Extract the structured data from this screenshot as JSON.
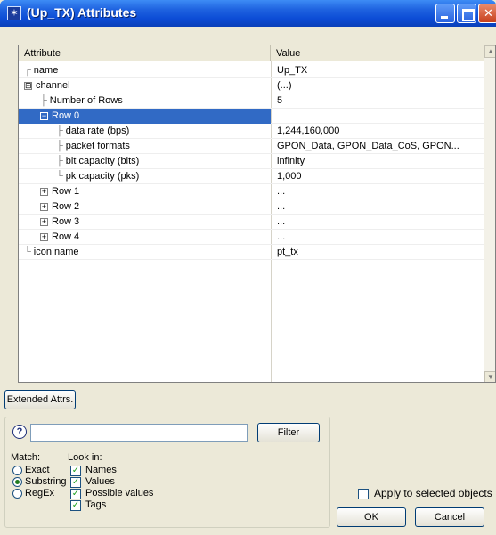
{
  "window": {
    "title": "(Up_TX) Attributes",
    "title_icon": "✶"
  },
  "grid": {
    "headers": {
      "attribute": "Attribute",
      "value": "Value"
    },
    "rows": [
      {
        "label": "name",
        "value": "Up_TX",
        "help": true,
        "indent": 0,
        "tree": "┌",
        "expander": ""
      },
      {
        "label": "channel",
        "value": "(...)",
        "help": true,
        "indent": 0,
        "tree": "",
        "expander": "⊟"
      },
      {
        "label": "Number of Rows",
        "value": "5",
        "help": true,
        "indent": 1,
        "tree": "├",
        "expander": ""
      },
      {
        "label": "Row 0",
        "value": "",
        "help": false,
        "indent": 1,
        "tree": "",
        "expander": "−",
        "selected": true
      },
      {
        "label": "data rate (bps)",
        "value": "1,244,160,000",
        "help": true,
        "indent": 2,
        "tree": "├",
        "expander": ""
      },
      {
        "label": "packet formats",
        "value": "GPON_Data, GPON_Data_CoS, GPON...",
        "help": true,
        "indent": 2,
        "tree": "├",
        "expander": ""
      },
      {
        "label": "bit capacity (bits)",
        "value": "infinity",
        "help": true,
        "indent": 2,
        "tree": "├",
        "expander": ""
      },
      {
        "label": "pk capacity (pks)",
        "value": "1,000",
        "help": true,
        "indent": 2,
        "tree": "└",
        "expander": ""
      },
      {
        "label": "Row 1",
        "value": "...",
        "help": false,
        "indent": 1,
        "tree": "",
        "expander": "+"
      },
      {
        "label": "Row 2",
        "value": "...",
        "help": false,
        "indent": 1,
        "tree": "",
        "expander": "+"
      },
      {
        "label": "Row 3",
        "value": "...",
        "help": false,
        "indent": 1,
        "tree": "",
        "expander": "+"
      },
      {
        "label": "Row 4",
        "value": "...",
        "help": false,
        "indent": 1,
        "tree": "",
        "expander": "+"
      },
      {
        "label": "icon name",
        "value": "pt_tx",
        "help": true,
        "indent": 0,
        "tree": "└",
        "expander": ""
      }
    ]
  },
  "buttons": {
    "extended_attrs": "Extended Attrs.",
    "filter": "Filter",
    "ok": "OK",
    "cancel": "Cancel"
  },
  "filter": {
    "input_value": "",
    "match_label": "Match:",
    "match_options": [
      {
        "label": "Exact",
        "selected": false
      },
      {
        "label": "Substring",
        "selected": true
      },
      {
        "label": "RegEx",
        "selected": false
      }
    ],
    "look_in_label": "Look in:",
    "look_in_options": [
      {
        "label": "Names",
        "checked": true
      },
      {
        "label": "Values",
        "checked": true
      },
      {
        "label": "Possible values",
        "checked": true
      },
      {
        "label": "Tags",
        "checked": true
      }
    ]
  },
  "apply": {
    "label": "Apply to selected objects",
    "checked": false
  },
  "icons": {
    "help": "?",
    "scroll_up": "▲",
    "scroll_down": "▼"
  }
}
